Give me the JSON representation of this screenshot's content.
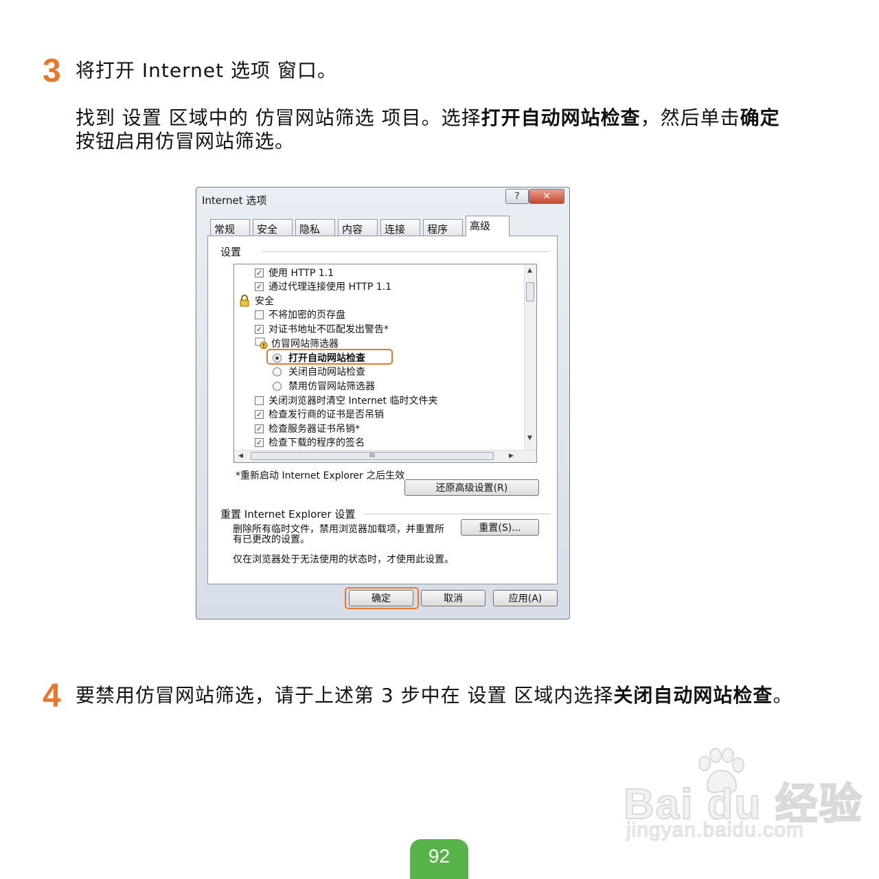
{
  "step3": {
    "number": "3",
    "line1": "将打开 Internet 选项 窗口。",
    "line2_a": "找到 设置 区域中的 仿冒网站筛选 项目。选择",
    "line2_b": "打开自动网站检查",
    "line2_c": "，然后单击",
    "line2_d": "确定",
    "line3": "按钮启用仿冒网站筛选。"
  },
  "dialog": {
    "title": "Internet 选项",
    "help_glyph": "?",
    "close_glyph": "✕",
    "tabs": [
      "常规",
      "安全",
      "隐私",
      "内容",
      "连接",
      "程序",
      "高级"
    ],
    "active_tab": "高级",
    "settings_label": "设置",
    "items": [
      {
        "kind": "checkbox",
        "checked": true,
        "label": "使用 HTTP 1.1"
      },
      {
        "kind": "checkbox",
        "checked": true,
        "label": "通过代理连接使用 HTTP 1.1"
      },
      {
        "kind": "category",
        "label": "安全"
      },
      {
        "kind": "checkbox",
        "checked": false,
        "label": "不将加密的页存盘"
      },
      {
        "kind": "checkbox",
        "checked": true,
        "label": "对证书地址不匹配发出警告*"
      },
      {
        "kind": "category",
        "label": "仿冒网站筛选器"
      },
      {
        "kind": "radio",
        "checked": true,
        "label": "打开自动网站检查"
      },
      {
        "kind": "radio",
        "checked": false,
        "label": "关闭自动网站检查"
      },
      {
        "kind": "radio",
        "checked": false,
        "label": "禁用仿冒网站筛选器"
      },
      {
        "kind": "checkbox",
        "checked": false,
        "label": "关闭浏览器时清空 Internet 临时文件夹"
      },
      {
        "kind": "checkbox",
        "checked": true,
        "label": "检查发行商的证书是否吊销"
      },
      {
        "kind": "checkbox",
        "checked": true,
        "label": "检查服务器证书吊销*"
      },
      {
        "kind": "checkbox",
        "checked": true,
        "label": "检查下载的程序的签名"
      }
    ],
    "hscroll_grip": "III",
    "restart_note": "*重新启动 Internet Explorer 之后生效",
    "restore_button": "还原高级设置(R)",
    "reset_group": "重置 Internet Explorer 设置",
    "reset_desc": "删除所有临时文件，禁用浏览器加载项，并重置所有已更改的设置。",
    "reset_button": "重置(S)...",
    "reset_warning": "仅在浏览器处于无法使用的状态时，才使用此设置。",
    "ok_button": "确定",
    "cancel_button": "取消",
    "apply_button": "应用(A)"
  },
  "step4": {
    "number": "4",
    "text_a": "要禁用仿冒网站筛选，请于上述第 3 步中在 设置 区域内选择",
    "text_b": "关闭自动网站检查",
    "text_c": "。"
  },
  "watermark": {
    "logo": "Bai du 经验",
    "url": "jingyan.baidu.com"
  },
  "page_number": "92",
  "colors": {
    "accent": "#e8772b",
    "page_tab": "#57b34a"
  }
}
